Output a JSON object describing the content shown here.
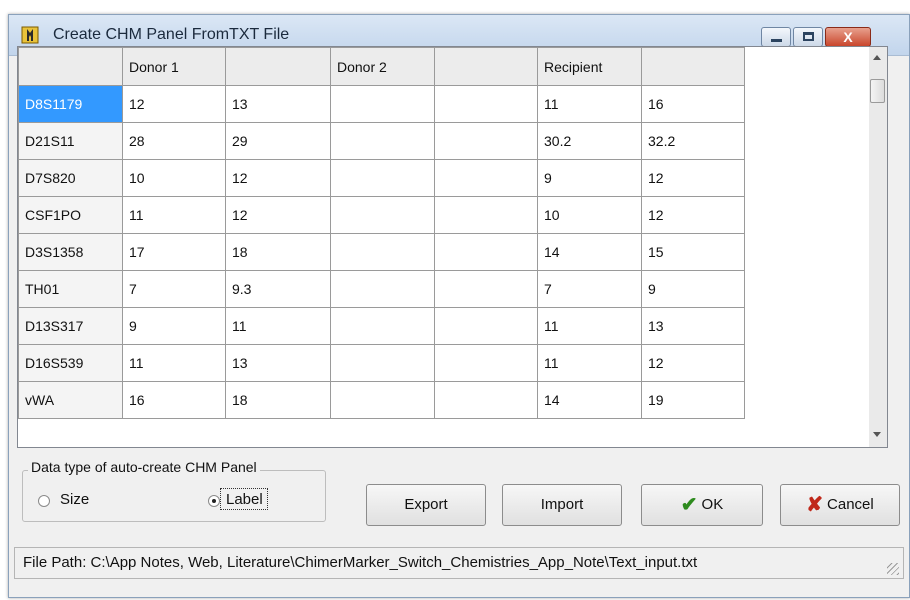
{
  "window": {
    "title": "Create CHM Panel FromTXT File",
    "icon": "chimermarker-app-icon",
    "controls": {
      "minimize": "minimize-icon",
      "maximize": "maximize-icon",
      "close": "X"
    }
  },
  "grid": {
    "headers": [
      "",
      "Donor 1",
      "",
      "Donor 2",
      "",
      "Recipient",
      ""
    ],
    "rows": [
      [
        "D8S1179",
        "12",
        "13",
        "",
        "",
        "11",
        "16"
      ],
      [
        "D21S11",
        "28",
        "29",
        "",
        "",
        "30.2",
        "32.2"
      ],
      [
        "D7S820",
        "10",
        "12",
        "",
        "",
        "9",
        "12"
      ],
      [
        "CSF1PO",
        "11",
        "12",
        "",
        "",
        "10",
        "12"
      ],
      [
        "D3S1358",
        "17",
        "18",
        "",
        "",
        "14",
        "15"
      ],
      [
        "TH01",
        "7",
        "9.3",
        "",
        "",
        "7",
        "9"
      ],
      [
        "D13S317",
        "9",
        "11",
        "",
        "",
        "11",
        "13"
      ],
      [
        "D16S539",
        "11",
        "13",
        "",
        "",
        "11",
        "12"
      ],
      [
        "vWA",
        "16",
        "18",
        "",
        "",
        "14",
        "19"
      ]
    ],
    "selected_cell": "D8S1179",
    "selection_color": "#3399ff"
  },
  "datatype": {
    "legend": "Data type of auto-create CHM Panel",
    "options": [
      {
        "label": "Size",
        "checked": false
      },
      {
        "label": "Label",
        "checked": true
      }
    ]
  },
  "buttons": {
    "export": "Export",
    "import": "Import",
    "ok": "OK",
    "cancel": "Cancel"
  },
  "status": {
    "file_path": "File Path: C:\\App Notes, Web, Literature\\ChimerMarker_Switch_Chemistries_App_Note\\Text_input.txt"
  }
}
